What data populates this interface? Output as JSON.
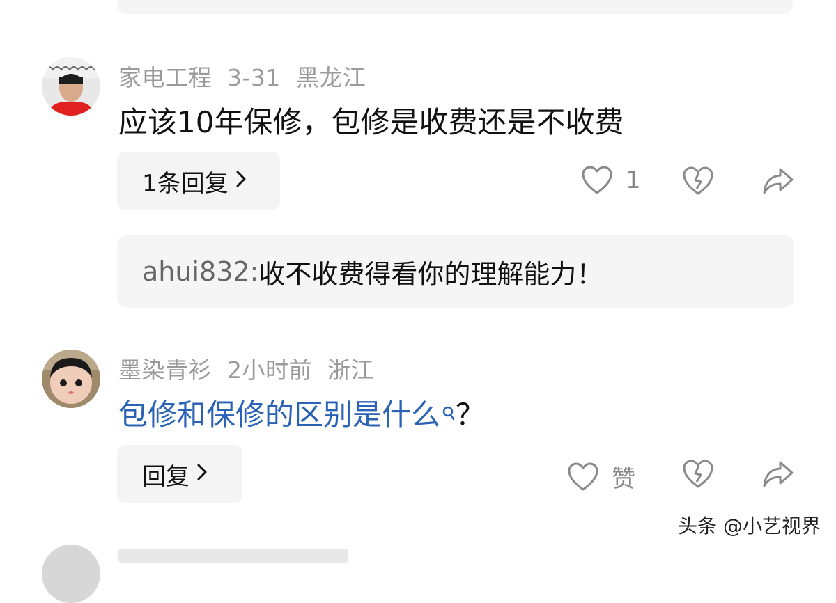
{
  "comments": [
    {
      "username": "家电工程",
      "date": "3-31",
      "location": "黑龙江",
      "text": "应该10年保修，包修是收费还是不收费",
      "reply_button": "1条回复",
      "likes": "1",
      "sub_reply": {
        "user": "ahui832:",
        "text": " 收不收费得看你的理解能力！"
      }
    },
    {
      "username": "墨染青衫",
      "date": "2小时前",
      "location": "浙江",
      "text_link": "包修和保修的区别是什么",
      "text_tail": "？",
      "reply_button": "回复",
      "likes": "赞"
    }
  ],
  "icons": {
    "like": "heart-outline-icon",
    "dislike": "broken-heart-icon",
    "share": "share-arrow-icon",
    "search": "search-icon",
    "chevron": "chevron-right-icon"
  },
  "colors": {
    "link": "#2a63b5",
    "meta": "#9a9a9a",
    "bubble": "#f4f4f4"
  },
  "watermark": "头条 @小艺视界"
}
